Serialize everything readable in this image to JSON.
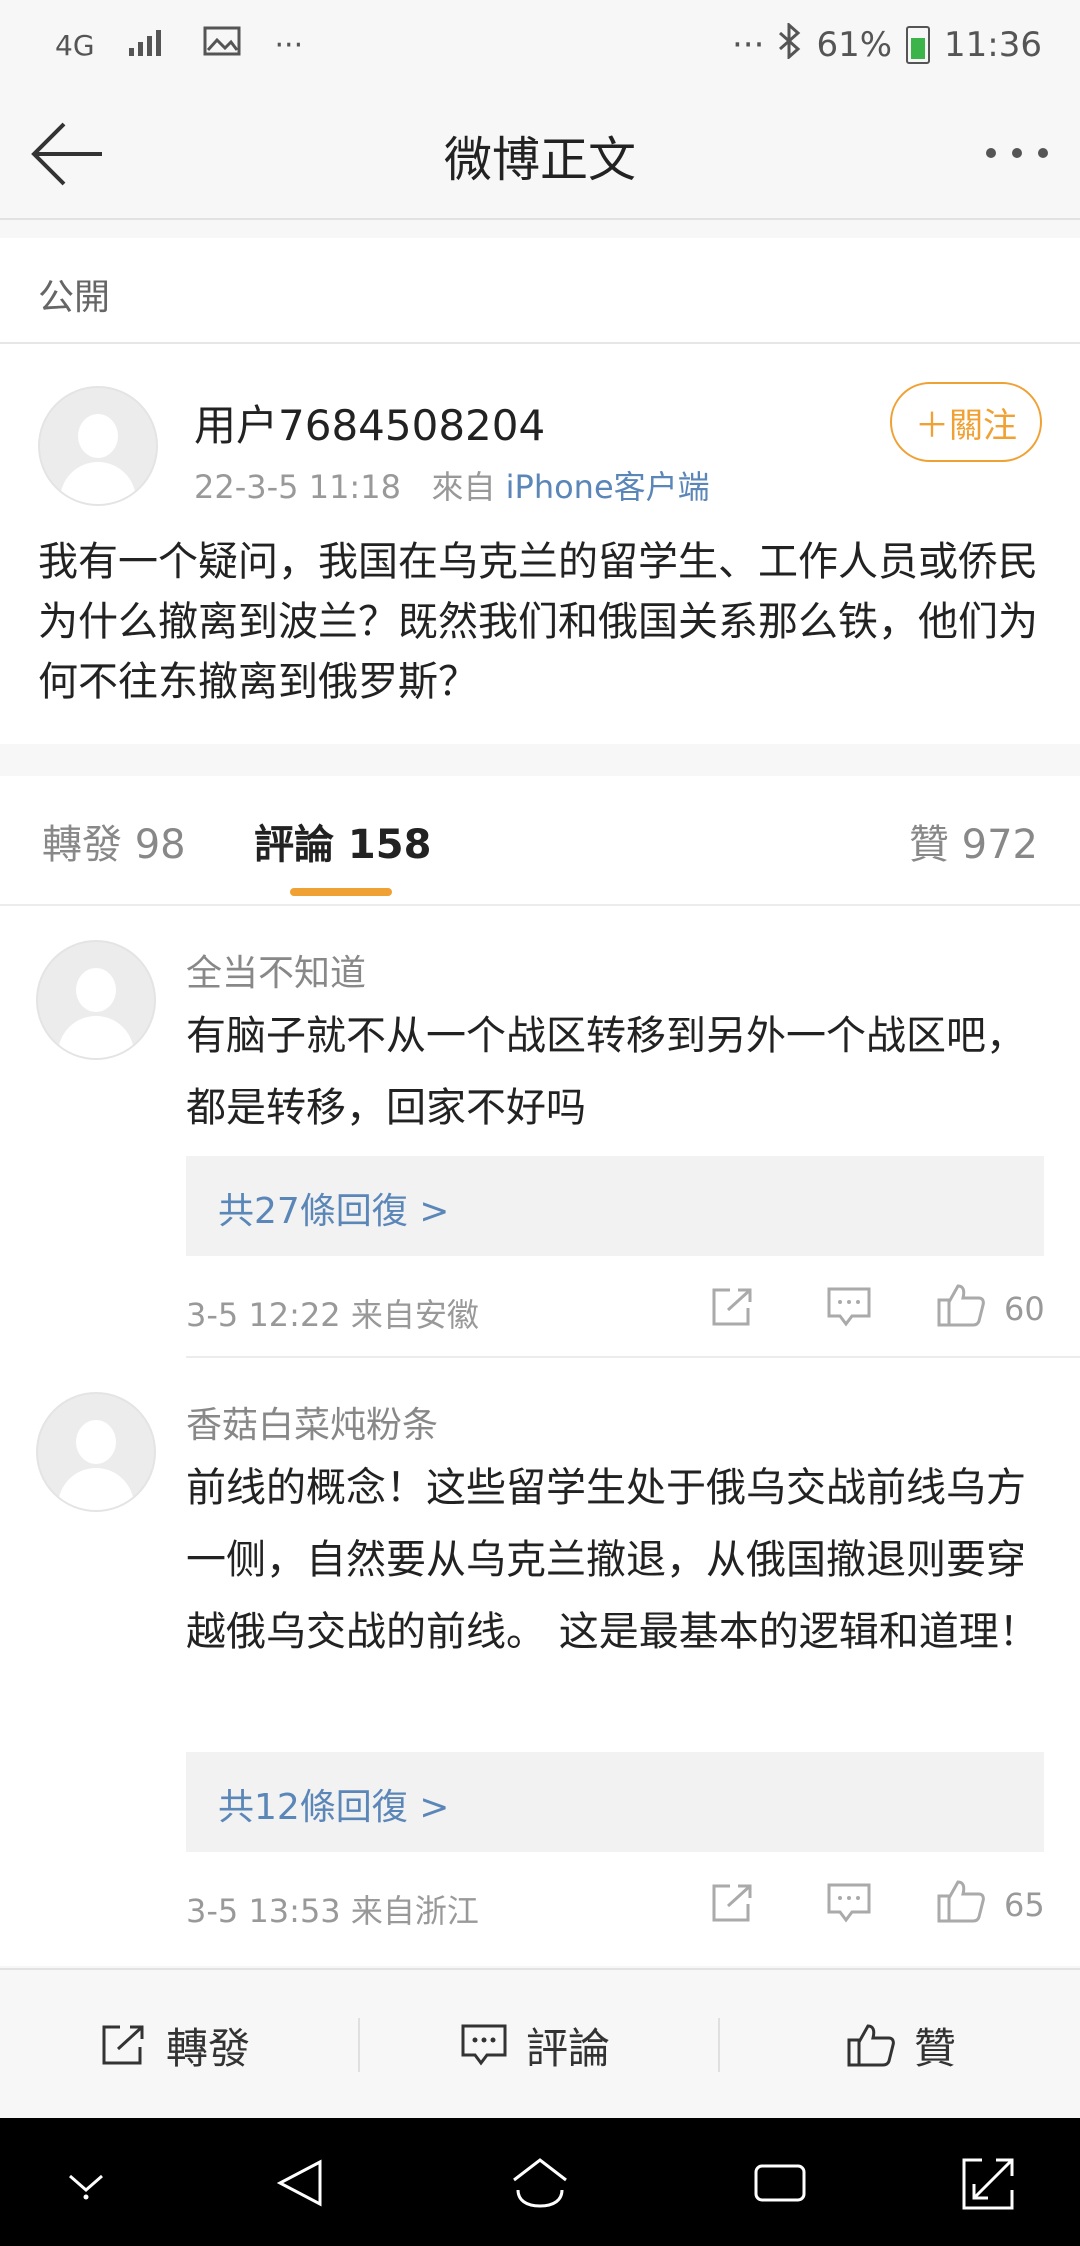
{
  "status_bar": {
    "network": "4G",
    "time": "11:36",
    "battery": "61%",
    "dots": "···"
  },
  "header": {
    "title": "微博正文"
  },
  "visibility": "公開",
  "post": {
    "username": "用户7684508204",
    "timestamp": "22-3-5 11:18",
    "source_prefix": "來自",
    "source": "iPhone客户端",
    "follow_label": "＋關注",
    "text": "我有一个疑问，我国在乌克兰的留学生、工作人员或侨民为什么撤离到波兰？既然我们和俄国关系那么铁，他们为何不往东撤离到俄罗斯？"
  },
  "tabs": {
    "repost": "轉發 98",
    "comments": "評論 158",
    "likes": "贊 972"
  },
  "comments": [
    {
      "name": "全当不知道",
      "text": "有脑子就不从一个战区转移到另外一个战区吧，都是转移，回家不好吗",
      "replies": "共27條回復 >",
      "meta": "3-5 12:22  来自安徽",
      "likes": "60"
    },
    {
      "name": "香菇白菜炖粉条",
      "text": "前线的概念！这些留学生处于俄乌交战前线乌方一侧，自然要从乌克兰撤退，从俄国撤退则要穿越俄乌交战的前线。 这是最基本的逻辑和道理！",
      "replies": "共12條回復 >",
      "meta": "3-5 13:53  来自浙江",
      "likes": "65"
    }
  ],
  "action_bar": {
    "repost": "轉發",
    "comment": "評論",
    "like": "贊"
  },
  "colors": {
    "accent": "#f0a134",
    "link": "#5b86b8"
  }
}
